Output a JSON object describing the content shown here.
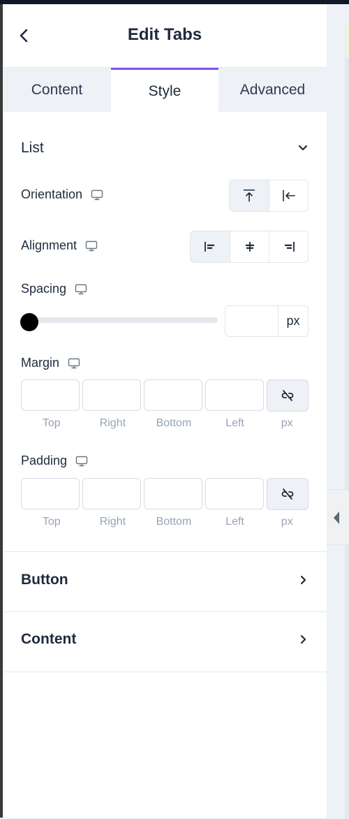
{
  "header": {
    "title": "Edit Tabs",
    "back_icon": "chevron-left-icon"
  },
  "tabs": [
    {
      "label": "Content",
      "active": false
    },
    {
      "label": "Style",
      "active": true
    },
    {
      "label": "Advanced",
      "active": false
    }
  ],
  "accent_color": "#8056e8",
  "sections": {
    "list": {
      "title": "List",
      "expanded": true,
      "orientation": {
        "label": "Orientation",
        "device_icon": "desktop-icon",
        "options": [
          {
            "icon": "align-top-arrow-icon",
            "active": true
          },
          {
            "icon": "align-left-arrow-icon",
            "active": false
          }
        ]
      },
      "alignment": {
        "label": "Alignment",
        "device_icon": "desktop-icon",
        "options": [
          {
            "icon": "align-start-icon",
            "active": true
          },
          {
            "icon": "align-center-icon",
            "active": false
          },
          {
            "icon": "align-end-icon",
            "active": false
          }
        ]
      },
      "spacing": {
        "label": "Spacing",
        "device_icon": "desktop-icon",
        "value": "",
        "slider_value": 0,
        "unit": "px"
      },
      "margin": {
        "label": "Margin",
        "device_icon": "desktop-icon",
        "fields": [
          "Top",
          "Right",
          "Bottom",
          "Left"
        ],
        "values": [
          "",
          "",
          "",
          ""
        ],
        "unit": "px",
        "linked": false
      },
      "padding": {
        "label": "Padding",
        "device_icon": "desktop-icon",
        "fields": [
          "Top",
          "Right",
          "Bottom",
          "Left"
        ],
        "values": [
          "",
          "",
          "",
          ""
        ],
        "unit": "px",
        "linked": false
      }
    },
    "button": {
      "title": "Button",
      "expanded": false
    },
    "content": {
      "title": "Content",
      "expanded": false
    }
  }
}
